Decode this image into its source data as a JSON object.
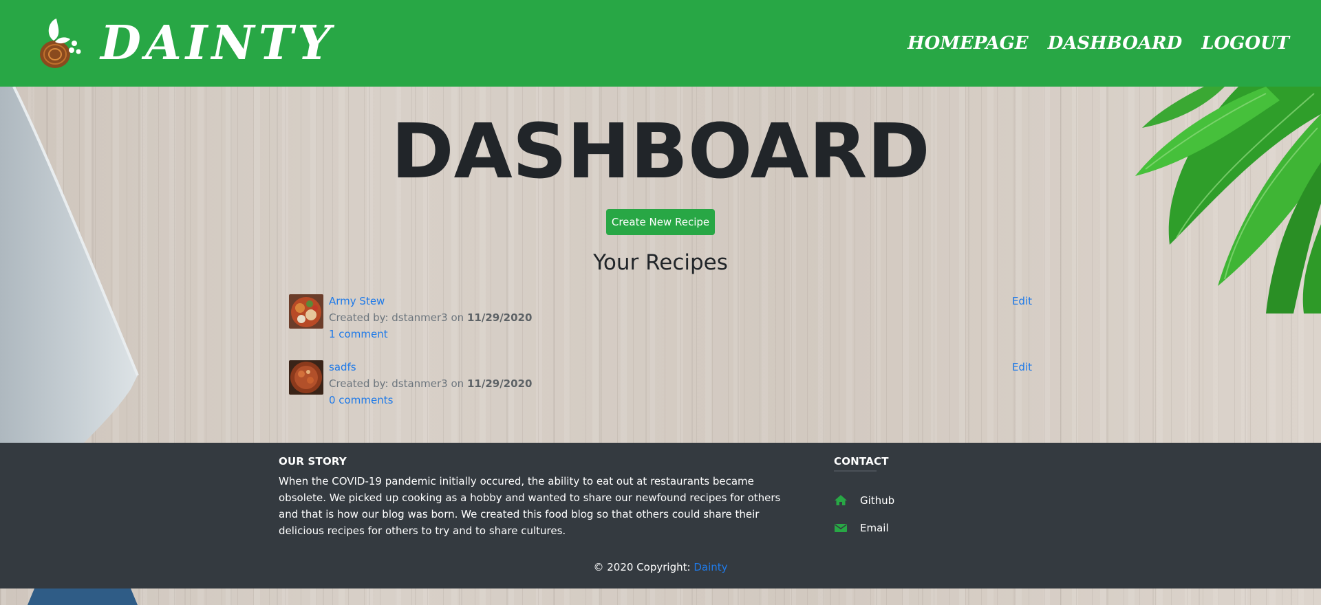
{
  "nav": {
    "brand": "DAINTY",
    "links": [
      "HOMEPAGE",
      "DASHBOARD",
      "LOGOUT"
    ]
  },
  "main": {
    "title": "DASHBOARD",
    "create_button": "Create New Recipe",
    "section_title": "Your Recipes",
    "recipes": [
      {
        "name": "Army Stew",
        "created_prefix": "Created by: dstanmer3 on",
        "date": "11/29/2020",
        "comments": "1 comment",
        "edit": "Edit"
      },
      {
        "name": "sadfs",
        "created_prefix": "Created by: dstanmer3 on",
        "date": "11/29/2020",
        "comments": "0 comments",
        "edit": "Edit"
      }
    ]
  },
  "footer": {
    "story_heading": "OUR STORY",
    "story_text": "When the COVID-19 pandemic initially occured, the ability to eat out at restaurants became obsolete. We picked up cooking as a hobby and wanted to share our newfound recipes for others and that is how our blog was born. We created this food blog so that others could share their delicious recipes for others to try and to share cultures.",
    "contact_heading": "CONTACT",
    "contact_items": [
      {
        "label": "Github",
        "icon": "home-icon"
      },
      {
        "label": "Email",
        "icon": "envelope-icon"
      }
    ],
    "copyright_prefix": "© 2020 Copyright:",
    "copyright_link": "Dainty"
  },
  "colors": {
    "brand_green": "#28a745",
    "footer_bg": "#343a40",
    "link_blue": "#1f7ae8"
  }
}
